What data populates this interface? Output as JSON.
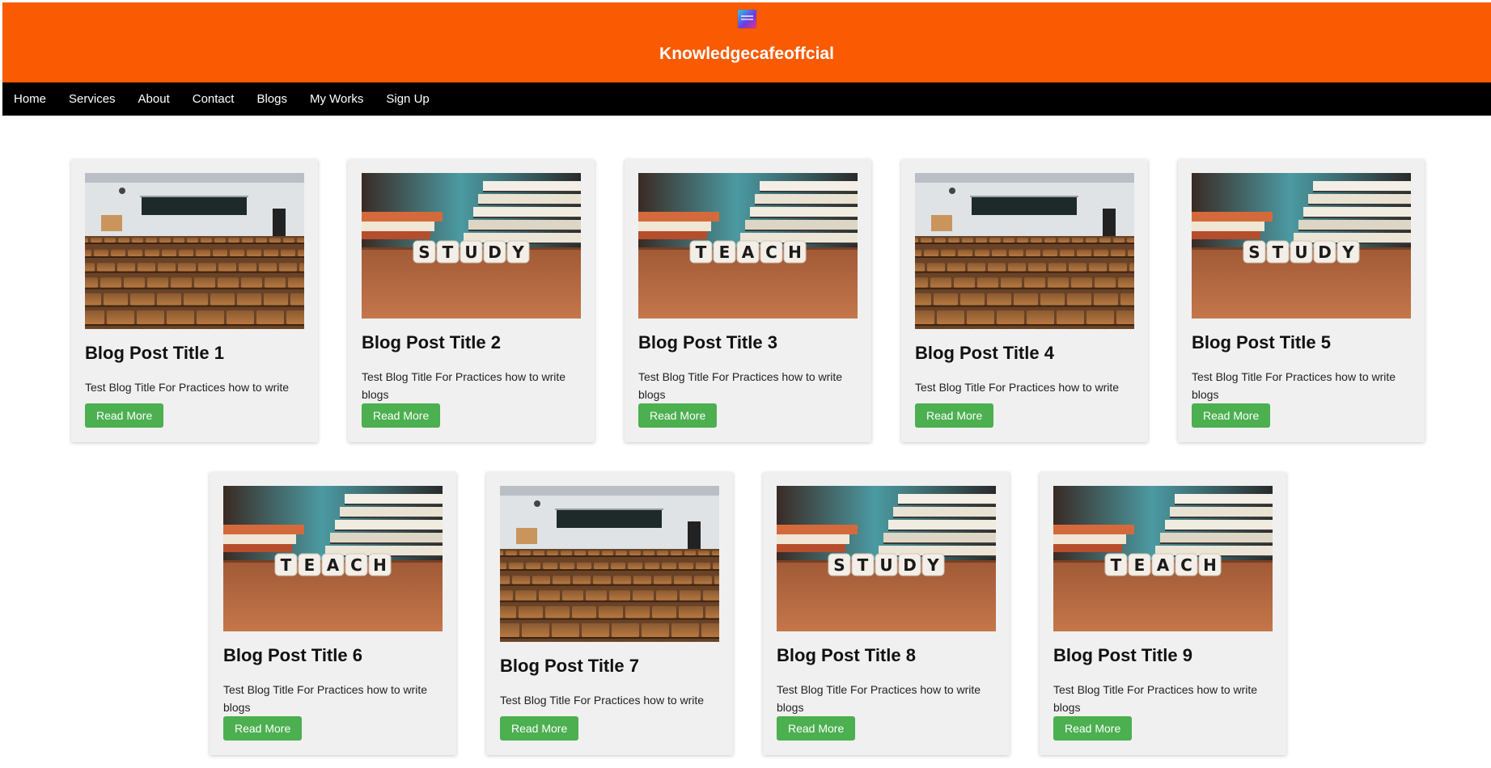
{
  "header": {
    "site_title": "Knowledgecafeoffcial",
    "logo_icon": "brand-logo-icon",
    "background_color": "#fa5a02"
  },
  "nav": {
    "items": [
      "Home",
      "Services",
      "About",
      "Contact",
      "Blogs",
      "My Works",
      "Sign Up"
    ]
  },
  "posts": [
    {
      "title": "Blog Post Title 1",
      "excerpt": "Test Blog Title For Practices how to write blogs",
      "button": "Read More",
      "image": "lecture-hall"
    },
    {
      "title": "Blog Post Title 2",
      "excerpt": "Test Blog Title For Practices how to write blogs",
      "button": "Read More",
      "image": "study-dice"
    },
    {
      "title": "Blog Post Title 3",
      "excerpt": "Test Blog Title For Practices how to write blogs",
      "button": "Read More",
      "image": "teach-dice"
    },
    {
      "title": "Blog Post Title 4",
      "excerpt": "Test Blog Title For Practices how to write blogs",
      "button": "Read More",
      "image": "lecture-hall"
    },
    {
      "title": "Blog Post Title 5",
      "excerpt": "Test Blog Title For Practices how to write blogs",
      "button": "Read More",
      "image": "study-dice"
    },
    {
      "title": "Blog Post Title 6",
      "excerpt": "Test Blog Title For Practices how to write blogs",
      "button": "Read More",
      "image": "teach-dice"
    },
    {
      "title": "Blog Post Title 7",
      "excerpt": "Test Blog Title For Practices how to write blogs",
      "button": "Read More",
      "image": "lecture-hall"
    },
    {
      "title": "Blog Post Title 8",
      "excerpt": "Test Blog Title For Practices how to write blogs",
      "button": "Read More",
      "image": "study-dice"
    },
    {
      "title": "Blog Post Title 9",
      "excerpt": "Test Blog Title For Practices how to write blogs",
      "button": "Read More",
      "image": "teach-dice"
    }
  ],
  "dice_words": {
    "study": "STUDY",
    "teach": "TEACH"
  },
  "colors": {
    "button": "#4caf50",
    "nav": "#000000",
    "card": "#f0f0f0"
  }
}
